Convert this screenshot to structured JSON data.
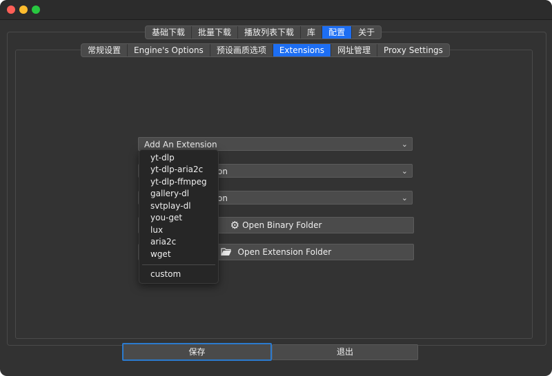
{
  "window": {
    "controls": [
      "close",
      "minimize",
      "maximize"
    ]
  },
  "main_tabs": [
    {
      "label": "基础下载",
      "active": false
    },
    {
      "label": "批量下载",
      "active": false
    },
    {
      "label": "播放列表下载",
      "active": false
    },
    {
      "label": "库",
      "active": false
    },
    {
      "label": "配置",
      "active": true
    },
    {
      "label": "关于",
      "active": false
    }
  ],
  "sub_tabs": [
    {
      "label": "常规设置",
      "active": false
    },
    {
      "label": "Engine's Options",
      "active": false
    },
    {
      "label": "预设画质选项",
      "active": false
    },
    {
      "label": "Extensions",
      "active": true
    },
    {
      "label": "网址管理",
      "active": false
    },
    {
      "label": "Proxy Settings",
      "active": false
    }
  ],
  "extensions": {
    "add_combo": "Add An Extension",
    "combo2_visible_tail": "on",
    "combo3_visible_tail": "on",
    "open_binary_label": "Open Binary Folder",
    "open_binary_icon": "gear-icon",
    "open_extension_label": "Open Extension Folder",
    "open_extension_icon": "folder-open-icon"
  },
  "dropdown": {
    "items": [
      "yt-dlp",
      "yt-dlp-aria2c",
      "yt-dlp-ffmpeg",
      "gallery-dl",
      "svtplay-dl",
      "you-get",
      "lux",
      "aria2c",
      "wget"
    ],
    "custom": "custom"
  },
  "footer": {
    "save_label": "保存",
    "quit_label": "退出"
  },
  "colors": {
    "accent": "#1d6ef3",
    "focus_ring": "#2b7bcf",
    "window_bg": "#323232"
  }
}
